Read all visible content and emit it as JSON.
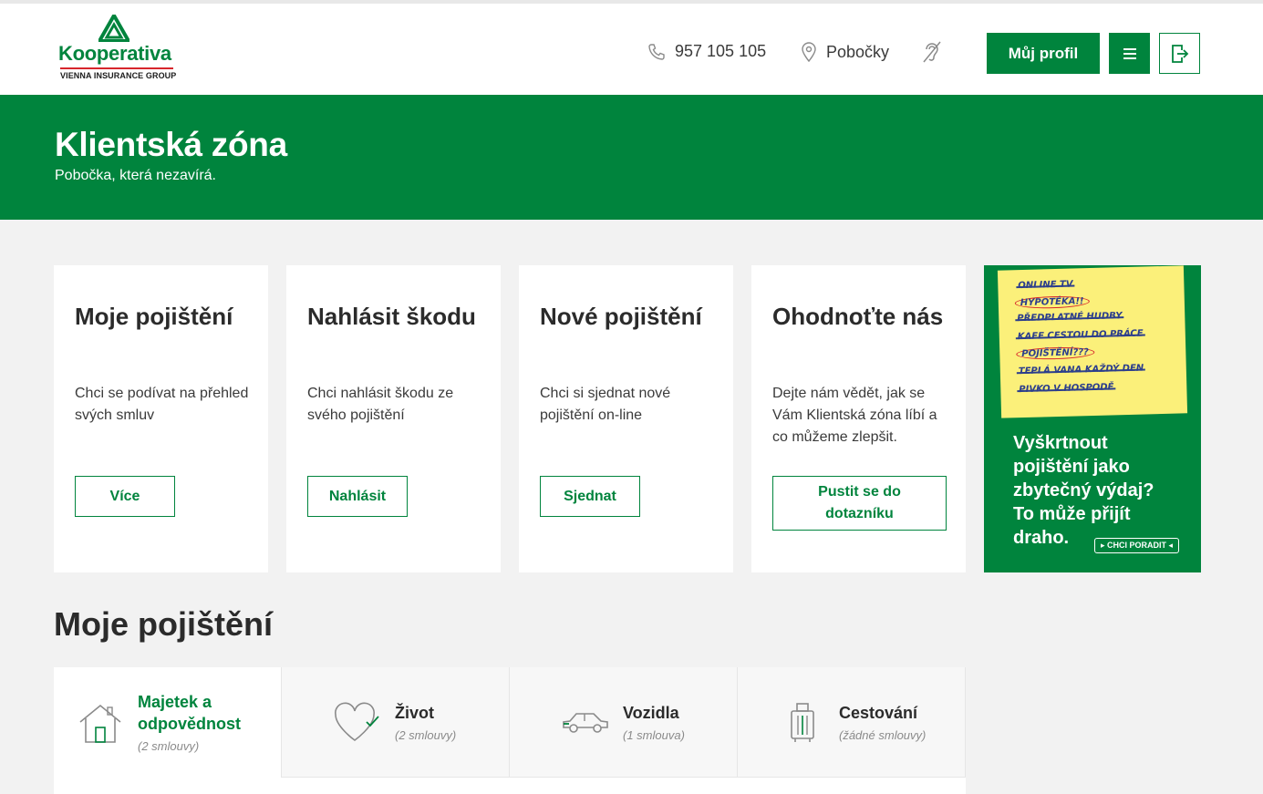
{
  "header": {
    "logo_brand": "Kooperativa",
    "logo_sub": "VIENNA INSURANCE GROUP",
    "phone": "957 105 105",
    "branches": "Pobočky",
    "profile_button": "Můj profil",
    "icons": [
      "phone-icon",
      "location-pin-icon",
      "hearing-icon",
      "menu-icon",
      "logout-icon"
    ]
  },
  "hero": {
    "title": "Klientská zóna",
    "subtitle": "Pobočka, která nezavírá."
  },
  "cards": [
    {
      "title": "Moje pojištění",
      "text": "Chci se podívat na přehled svých smluv",
      "button": "Více"
    },
    {
      "title": "Nahlásit škodu",
      "text": "Chci nahlásit škodu ze svého pojištění",
      "button": "Nahlásit"
    },
    {
      "title": "Nové pojištění",
      "text": "Chci si sjednat nové pojištění on-line",
      "button": "Sjednat"
    },
    {
      "title": "Ohodnoťte nás",
      "text": "Dejte nám vědět, jak se Vám Klientská zóna líbí a co můžeme zlepšit.",
      "button": "Pustit se do dotazníku"
    }
  ],
  "ad": {
    "note_lines": [
      "ONLINE TV",
      "HYPOTÉKA!!",
      "PŘEDPLATNÉ HUDBY",
      "KAFE CESTOU DO PRÁCE",
      "POJIŠTĚNÍ???",
      "TEPLÁ VANA KAŽDÝ DEN",
      "PIVKO V HOSPODĚ"
    ],
    "headline": "Vyškrtnout pojištění jako zbytečný výdaj? To může přijít draho.",
    "cta": "▸ CHCI PORADIT ◂"
  },
  "section": {
    "title": "Moje pojištění",
    "tabs": [
      {
        "label": "Majetek a odpovědnost",
        "count": "(2 smlouvy)",
        "icon": "house-icon",
        "active": true
      },
      {
        "label": "Život",
        "count": "(2 smlouvy)",
        "icon": "heart-icon",
        "active": false
      },
      {
        "label": "Vozidla",
        "count": "(1 smlouva)",
        "icon": "car-icon",
        "active": false
      },
      {
        "label": "Cestování",
        "count": "(žádné smlouvy)",
        "icon": "suitcase-icon",
        "active": false
      }
    ]
  },
  "colors": {
    "brand_green": "#00843d",
    "accent_red": "#d7262c",
    "background": "#f2f2f2"
  }
}
